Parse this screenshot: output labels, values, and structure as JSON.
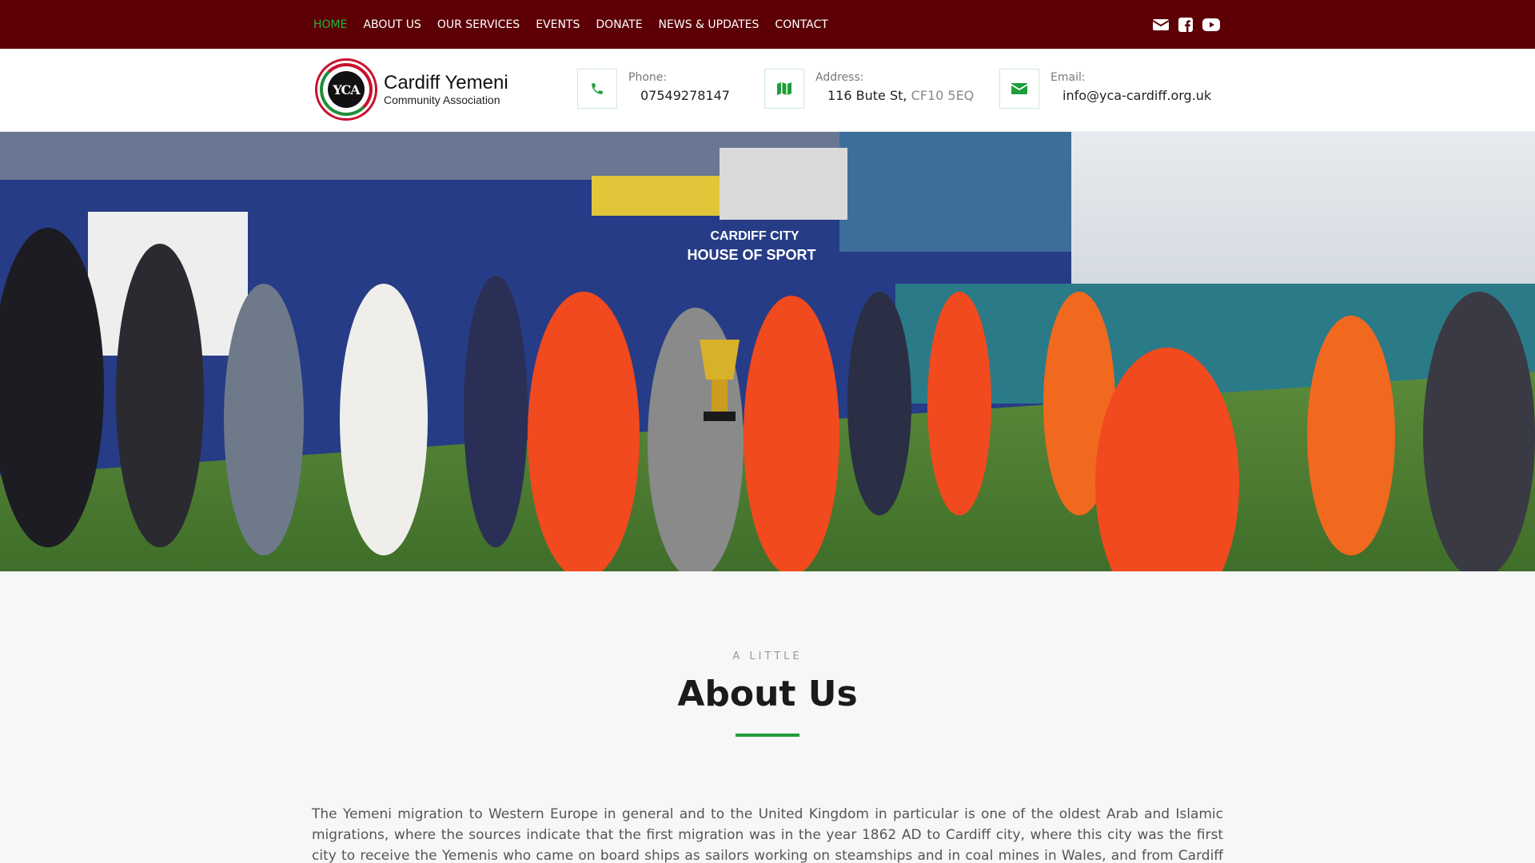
{
  "nav": {
    "items": [
      {
        "label": "HOME",
        "active": true
      },
      {
        "label": "ABOUT US"
      },
      {
        "label": "OUR SERVICES"
      },
      {
        "label": "EVENTS"
      },
      {
        "label": "DONATE"
      },
      {
        "label": "NEWS & UPDATES"
      },
      {
        "label": "CONTACT"
      }
    ],
    "social_icons": [
      "envelope-icon",
      "facebook-icon",
      "youtube-icon"
    ]
  },
  "header": {
    "logo": {
      "name": "Cardiff Yemeni",
      "subtitle": "Community Association",
      "emblem_text": "YCA"
    },
    "phone": {
      "label": "Phone:",
      "value": "07549278147"
    },
    "address": {
      "label": "Address:",
      "value": "116 Bute St,",
      "postcode": "CF10 5EQ"
    },
    "email": {
      "label": "Email:",
      "value": "info@yca-cardiff.org.uk"
    }
  },
  "hero": {
    "icon": "photo-football-award-ceremony",
    "sign_line1": "CARDIFF CITY",
    "sign_line2": "HOUSE OF SPORT"
  },
  "about": {
    "kicker": "A LITTLE",
    "title": "About Us",
    "paragraph": "The Yemeni migration to Western Europe in general and to the United Kingdom in particular is one of the oldest Arab and Islamic migrations, where the sources indicate that the first migration was in the year 1862 AD to Cardiff city, where this city was the first city to receive the Yemenis who came on board ships as sailors working on steamships and in coal mines in Wales, and from Cardiff they set out to the rest of"
  },
  "colors": {
    "topbar": "#5c0006",
    "accent_green": "#23b33a",
    "brand_red": "#c8102e"
  }
}
